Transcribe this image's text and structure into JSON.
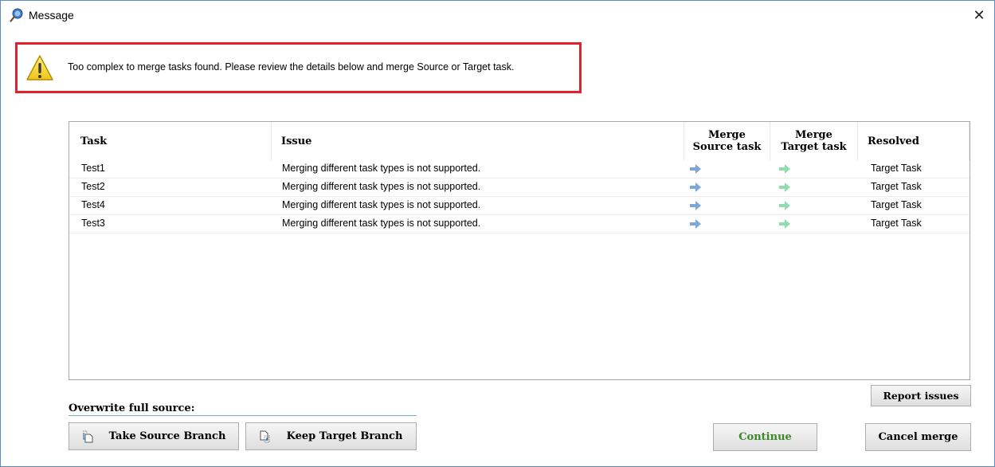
{
  "window": {
    "title": "Message",
    "close_glyph": "✕",
    "title_icon": "message-icon"
  },
  "alert": {
    "icon": "warning-icon",
    "text": "Too complex to merge tasks found. Please review the details below and merge Source or Target task.",
    "border_color": "#e3202b"
  },
  "table": {
    "columns": {
      "task": "Task",
      "issue": "Issue",
      "merge_source_line1": "Merge",
      "merge_source_line2": "Source task",
      "merge_target_line1": "Merge",
      "merge_target_line2": "Target task",
      "resolved": "Resolved"
    },
    "rows": [
      {
        "task": "Test1",
        "issue": "Merging different task types is not supported.",
        "resolved": "Target Task"
      },
      {
        "task": "Test2",
        "issue": "Merging different task types is not supported.",
        "resolved": "Target Task"
      },
      {
        "task": "Test4",
        "issue": "Merging different task types is not supported.",
        "resolved": "Target Task"
      },
      {
        "task": "Test3",
        "issue": "Merging different task types is not supported.",
        "resolved": "Target Task"
      }
    ],
    "source_arrow_color": "#7fa6d9",
    "target_arrow_color": "#8fdcae"
  },
  "overwrite": {
    "label": "Overwrite full source:",
    "take_source": "Take Source Branch",
    "keep_target": "Keep Target Branch"
  },
  "buttons": {
    "report": "Report issues",
    "continue": "Continue",
    "cancel": "Cancel merge",
    "continue_color": "#3a8a24"
  }
}
